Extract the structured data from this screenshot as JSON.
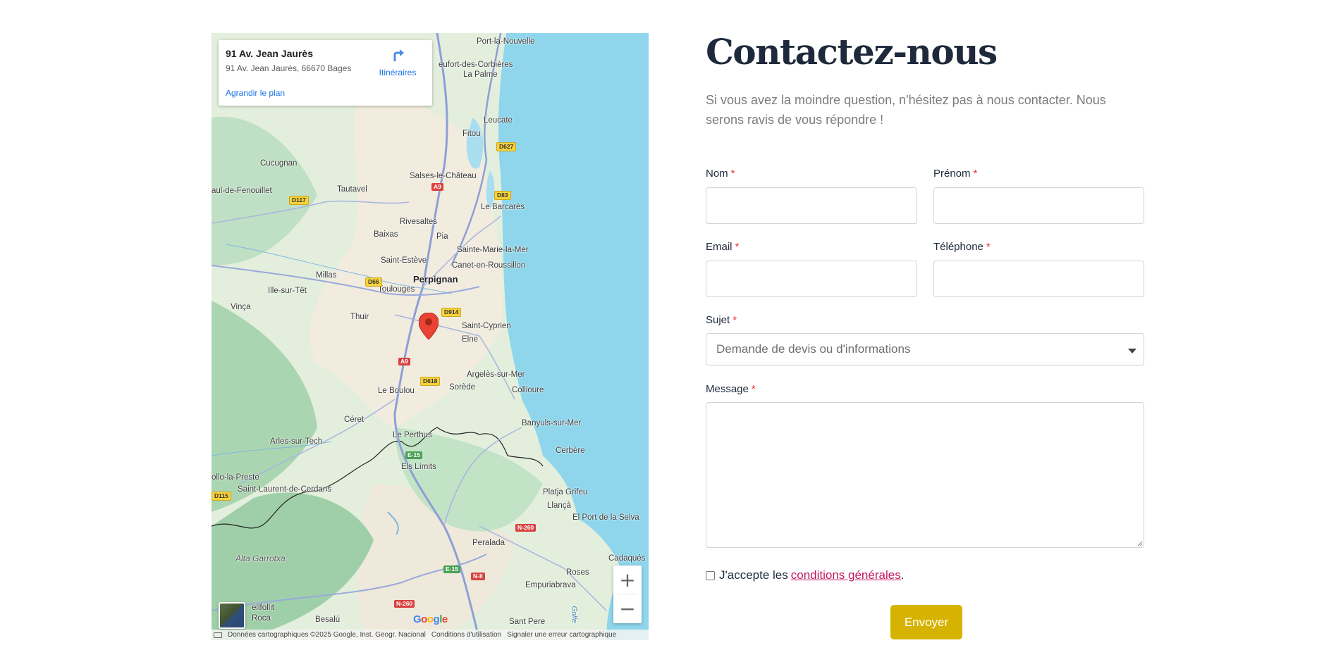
{
  "map": {
    "info": {
      "title": "91 Av. Jean Jaurès",
      "address": "91 Av. Jean Jaurès, 66670 Bages",
      "enlarge": "Agrandir le plan",
      "directions": "Itinéraires"
    },
    "places": [
      "Port-la-Nouvelle",
      "eufort-des-Corbières",
      "La Palme",
      "Leucate",
      "Fitou",
      "Cucugnan",
      "Salses-le-Château",
      "aul-de-Fenouillet",
      "Tautavel",
      "Le Barcarès",
      "Rivesaltes",
      "Baixas",
      "Pia",
      "Sainte-Marie-la-Mer",
      "Saint-Estève",
      "Canet-en-Roussillon",
      "Millas",
      "Perpignan",
      "Ille-sur-Têt",
      "Toulouges",
      "Vinça",
      "Thuir",
      "Saint-Cyprien",
      "Elne",
      "Argelès-sur-Mer",
      "Le Boulou",
      "Sorède",
      "Collioure",
      "Céret",
      "Banyuls-sur-Mer",
      "Le Perthus",
      "Arles-sur-Tech",
      "Cerbère",
      "Els Límits",
      "ollo-la-Preste",
      "Saint-Laurent-de-Cerdans",
      "Platja Grifeu",
      "Llançà",
      "El Port de la Selva",
      "Peralada",
      "Cadaqués",
      "Roses",
      "Empuriabrava",
      "ellfollit",
      "Roca",
      "Besalú",
      "Sant Pere"
    ],
    "region_label": "Alta Garrotxa",
    "water_label": "Golfe",
    "roads": [
      "D627",
      "A9",
      "D83",
      "D117",
      "D66",
      "D914",
      "A9",
      "D618",
      "E-15",
      "D115",
      "N-260",
      "E-15",
      "N-II",
      "N-260"
    ],
    "zoom_in": "+",
    "zoom_out": "−",
    "google": "Google",
    "attribution": {
      "shortcut": "Raccourcis clavier",
      "data": "Données cartographiques ©2025 Google, Inst. Geogr. Nacional",
      "terms": "Conditions d'utilisation",
      "report": "Signaler une erreur cartographique"
    }
  },
  "contact": {
    "title": "Contactez-nous",
    "intro": "Si vous avez la moindre question, n'hésitez pas à nous contacter. Nous serons ravis de vous répondre !",
    "required_mark": "*",
    "fields": {
      "nom": "Nom",
      "prenom": "Prénom",
      "email": "Email",
      "telephone": "Téléphone",
      "sujet": "Sujet",
      "message": "Message"
    },
    "sujet_selected": "Demande de devis ou d'informations",
    "consent_prefix": "J'accepte les",
    "consent_link": "conditions générales",
    "consent_suffix": ".",
    "submit": "Envoyer"
  },
  "colors": {
    "accent": "#d6b300",
    "link": "#c2185b",
    "required": "#e53935",
    "title": "#1e2a3b"
  }
}
